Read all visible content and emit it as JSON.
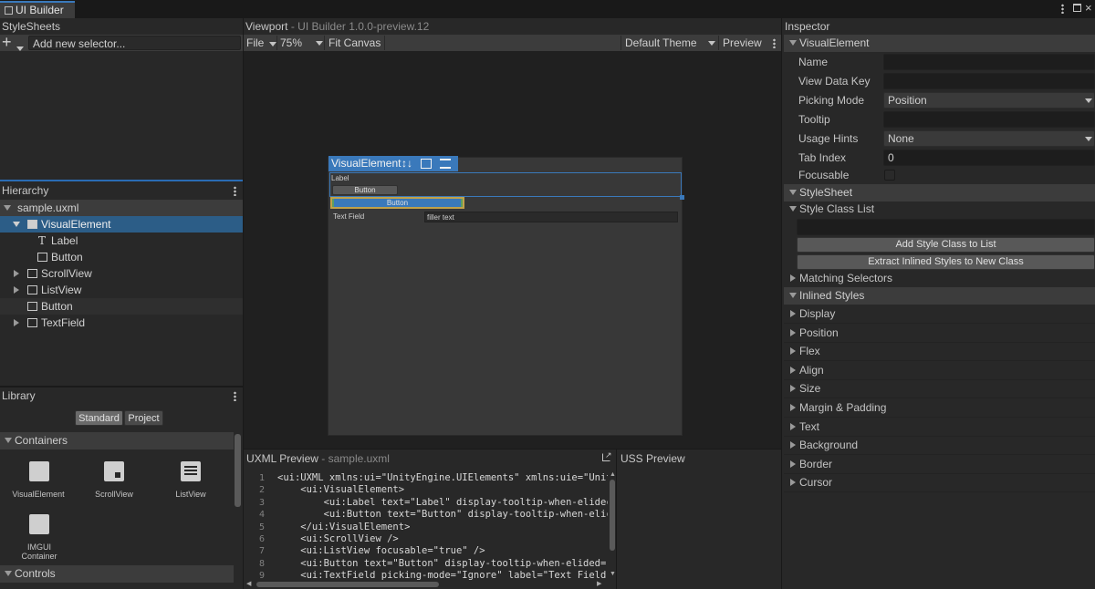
{
  "window": {
    "tab_title": "UI Builder"
  },
  "stylesheets": {
    "title": "StyleSheets",
    "add_selector_placeholder": "Add new selector..."
  },
  "hierarchy": {
    "title": "Hierarchy",
    "root": "sample.uxml",
    "items": [
      {
        "label": "VisualElement",
        "icon": "visual-element-icon"
      },
      {
        "label": "Label",
        "icon": "label-icon"
      },
      {
        "label": "Button",
        "icon": "button-icon"
      },
      {
        "label": "ScrollView",
        "icon": "scrollview-icon"
      },
      {
        "label": "ListView",
        "icon": "listview-icon"
      },
      {
        "label": "Button",
        "icon": "button-icon"
      },
      {
        "label": "TextField",
        "icon": "textfield-icon"
      }
    ]
  },
  "library": {
    "title": "Library",
    "tabs": [
      "Standard",
      "Project"
    ],
    "containers_title": "Containers",
    "controls_title": "Controls",
    "items": [
      "VisualElement",
      "ScrollView",
      "ListView",
      "IMGUI Container"
    ]
  },
  "viewport": {
    "title": "Viewport",
    "subtitle": "UI Builder 1.0.0-preview.12",
    "file_menu": "File",
    "zoom": "75%",
    "fit_canvas": "Fit Canvas",
    "theme": "Default Theme",
    "preview": "Preview",
    "canvas": {
      "selected_tag": "VisualElement",
      "label_text": "Label",
      "button_text": "Button",
      "button2_text": "Button",
      "textfield_label": "Text Field",
      "textfield_value": "filler text"
    }
  },
  "uxml_preview": {
    "title": "UXML Preview",
    "file": "sample.uxml",
    "line_numbers": [
      "1",
      "2",
      "3",
      "4",
      "5",
      "6",
      "7",
      "8",
      "9"
    ],
    "lines": [
      "<ui:UXML xmlns:ui=\"UnityEngine.UIElements\" xmlns:uie=\"Unit",
      "    <ui:VisualElement>",
      "        <ui:Label text=\"Label\" display-tooltip-when-elidec",
      "        <ui:Button text=\"Button\" display-tooltip-when-elic",
      "    </ui:VisualElement>",
      "    <ui:ScrollView />",
      "    <ui:ListView focusable=\"true\" />",
      "    <ui:Button text=\"Button\" display-tooltip-when-elided=\"",
      "    <ui:TextField picking-mode=\"Ignore\" label=\"Text Field\""
    ]
  },
  "uss_preview": {
    "title": "USS Preview"
  },
  "inspector": {
    "title": "Inspector",
    "section_visual_element": "VisualElement",
    "fields": {
      "name": "Name",
      "view_data_key": "View Data Key",
      "picking_mode": "Picking Mode",
      "picking_mode_value": "Position",
      "tooltip": "Tooltip",
      "usage_hints": "Usage Hints",
      "usage_hints_value": "None",
      "tab_index": "Tab Index",
      "tab_index_value": "0",
      "focusable": "Focusable"
    },
    "section_stylesheet": "StyleSheet",
    "style_class_list": "Style Class List",
    "add_style_class": "Add Style Class to List",
    "extract_inlined": "Extract Inlined Styles to New Class",
    "matching_selectors": "Matching Selectors",
    "section_inlined": "Inlined Styles",
    "inlined_groups": [
      "Display",
      "Position",
      "Flex",
      "Align",
      "Size",
      "Margin & Padding",
      "Text",
      "Background",
      "Border",
      "Cursor"
    ]
  },
  "colors": {
    "selection": "#2c5d87",
    "accent_blue": "#3a79bb",
    "panel": "#282828",
    "background": "#191919"
  }
}
